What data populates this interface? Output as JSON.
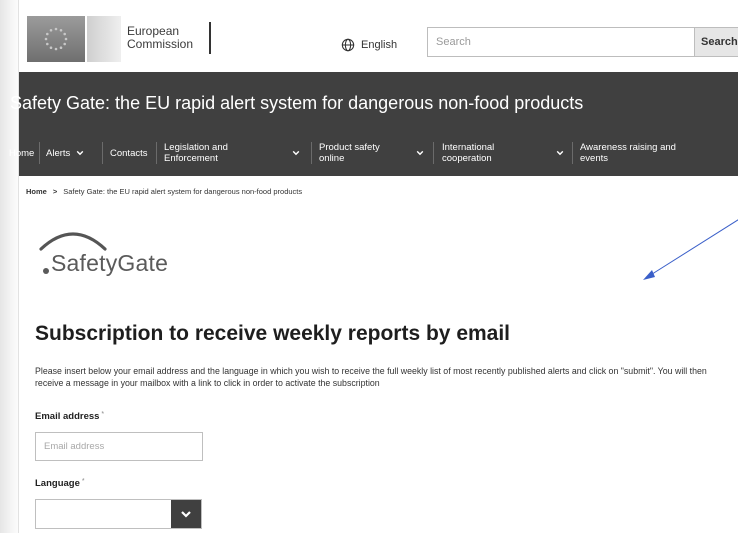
{
  "header": {
    "logo_line1": "European",
    "logo_line2": "Commission",
    "language_label": "English",
    "search_placeholder": "Search",
    "search_button_label": "Search"
  },
  "site_title": "Safety Gate: the EU rapid alert system for dangerous non-food products",
  "nav": {
    "items": [
      {
        "line1": "Home",
        "line2": ""
      },
      {
        "line1": "Alerts",
        "line2": ""
      },
      {
        "line1": "Contacts",
        "line2": ""
      },
      {
        "line1": "Legislation and",
        "line2": "Enforcement"
      },
      {
        "line1": "Product safety",
        "line2": "online"
      },
      {
        "line1": "International",
        "line2": "cooperation"
      },
      {
        "line1": "Awareness raising and",
        "line2": "events"
      }
    ]
  },
  "breadcrumb": {
    "home": "Home",
    "separator": ">",
    "current": "Safety Gate: the EU rapid alert system for dangerous non-food products"
  },
  "safety_gate_logo_text": "SafetyGate",
  "form": {
    "title": "Subscription to receive weekly reports by email",
    "intro": "Please insert below your email address and the language in which you wish to receive the full weekly list of most recently published alerts and click on \"submit\". You will then receive a message in your mailbox with a link to click in order to activate the subscription",
    "email_label": "Email address",
    "email_placeholder": "Email address",
    "email_value": "",
    "required_marker": "*",
    "language_label": "Language",
    "language_selected": ""
  },
  "colors": {
    "dark_band": "#404040",
    "annotation_arrow": "#3a5fc9"
  },
  "icons": [
    "globe-icon",
    "chevron-down-icon",
    "arrow-annotation"
  ]
}
